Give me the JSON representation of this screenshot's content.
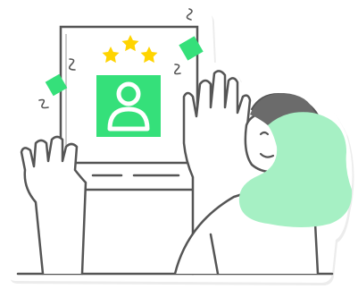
{
  "illustration": {
    "icons": {
      "stars": "star-icon",
      "avatar": "user-avatar-icon",
      "confetti": "confetti-icon",
      "squiggle": "squiggle-icon"
    },
    "rating": {
      "filled": 3,
      "total": 3
    },
    "colors": {
      "outline": "#555555",
      "accent_green": "#35e07a",
      "light_green": "#a6f0c4",
      "star_yellow": "#ffd400",
      "hair": "#6b6b6b",
      "sticker_bg": "#ffffff",
      "sticker_shadow": "#e9e9e9"
    }
  }
}
